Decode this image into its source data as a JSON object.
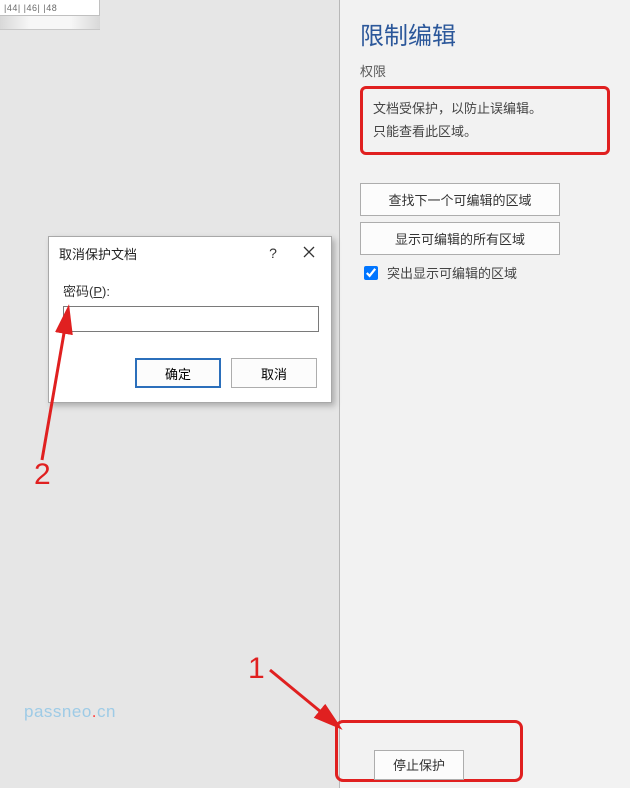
{
  "ruler": {
    "marks": "|44|  |46|  |48"
  },
  "panel": {
    "title": "限制编辑",
    "subtitle": "权限",
    "info_line1": "文档受保护，以防止误编辑。",
    "info_line2": "只能查看此区域。",
    "btn_find_next": "查找下一个可编辑的区域",
    "btn_show_all": "显示可编辑的所有区域",
    "chk_highlight": "突出显示可编辑的区域",
    "btn_stop": "停止保护"
  },
  "dialog": {
    "title": "取消保护文档",
    "help": "?",
    "password_label_pre": "密码(",
    "password_label_key": "P",
    "password_label_post": "):",
    "password_value": "",
    "ok": "确定",
    "cancel": "取消"
  },
  "annotations": {
    "one": "1",
    "two": "2"
  },
  "watermark": {
    "text_a": "passneo",
    "dot": ".",
    "text_b": "cn"
  }
}
